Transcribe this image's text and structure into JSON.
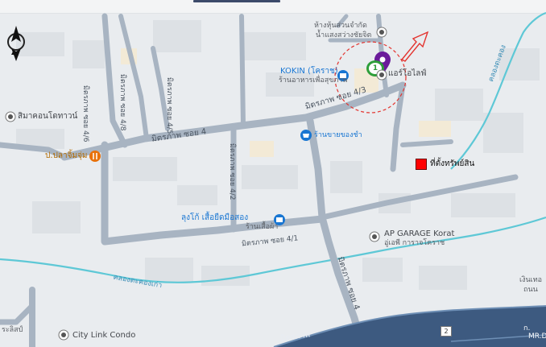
{
  "map": {
    "places": {
      "hangthun": {
        "line1": "ห้างหุ้นส่วนจำกัด",
        "line2": "น้ำแสงสว่างชัยจิต"
      },
      "airoilai": {
        "label": "แอร์โอไลฟ์"
      },
      "kokin": {
        "name": "KOKIN (โคราช)",
        "sub": "ร้านอาหารเพื่อสุขภาพ"
      },
      "simacon": {
        "label": "สิมาคอนโดทาวน์"
      },
      "plajumjum": {
        "label": "ป.ปลาจิ้มจุ่ม"
      },
      "shop_sale": {
        "label": "ร้านขายของชำ"
      },
      "lungko": {
        "name": "ลุงโก้ เสื้อยืดมือสอง",
        "sub": "ร้านเสื้อผ้า"
      },
      "apgarage": {
        "name": "AP GARAGE Korat",
        "sub": "อู่เอพี การาจโคราช"
      },
      "citylink": {
        "label": "City Link Condo"
      },
      "right_cut1": {
        "label": "เงินเทอ"
      },
      "right_cut2": {
        "label": "ถนน"
      },
      "left_cut": {
        "label": "ระลิสป์"
      },
      "mrd": {
        "label": "MR.D"
      },
      "right_g": {
        "label": "ก."
      }
    },
    "roads": {
      "soi4": "มิตรภาพ ซอย 4",
      "soi4_vertical": "มิตรภาพ ซอย 4",
      "soi4_8": "มิตรภาพ ซอย 4/8",
      "soi4_6": "มิตรภาพ ซอย 4/6",
      "soi4_5": "มิตรภาพ ซอย 4/5",
      "soi4_3": "มิตรภาพ ซอย 4/3",
      "soi4_1": "มิตรภาพ ซอย 4/1",
      "soi4_2": "มิตรภาพ ซอย 4/2",
      "highway": "มิตรภาพ"
    },
    "waterway": {
      "canal_left": "คลองตะคองเก่า",
      "canal_right": "คลองตะคอง"
    },
    "shield_number": "2",
    "pin_green_number": "1",
    "legend": {
      "label": "ที่ตั้งทรัพย์สิน",
      "color": "#ff0000"
    },
    "colors": {
      "road": "#a8b4c2",
      "water": "#5ec8d6",
      "block": "#dde1e5",
      "accent_circle": "#e3342f",
      "pin_purple": "#6a1b9a",
      "pin_green": "#2e9e3a"
    },
    "icons": [
      "compass-icon",
      "marker-purple-icon",
      "marker-green-icon",
      "arrow-icon",
      "store-icon",
      "restaurant-icon",
      "place-icon"
    ]
  }
}
